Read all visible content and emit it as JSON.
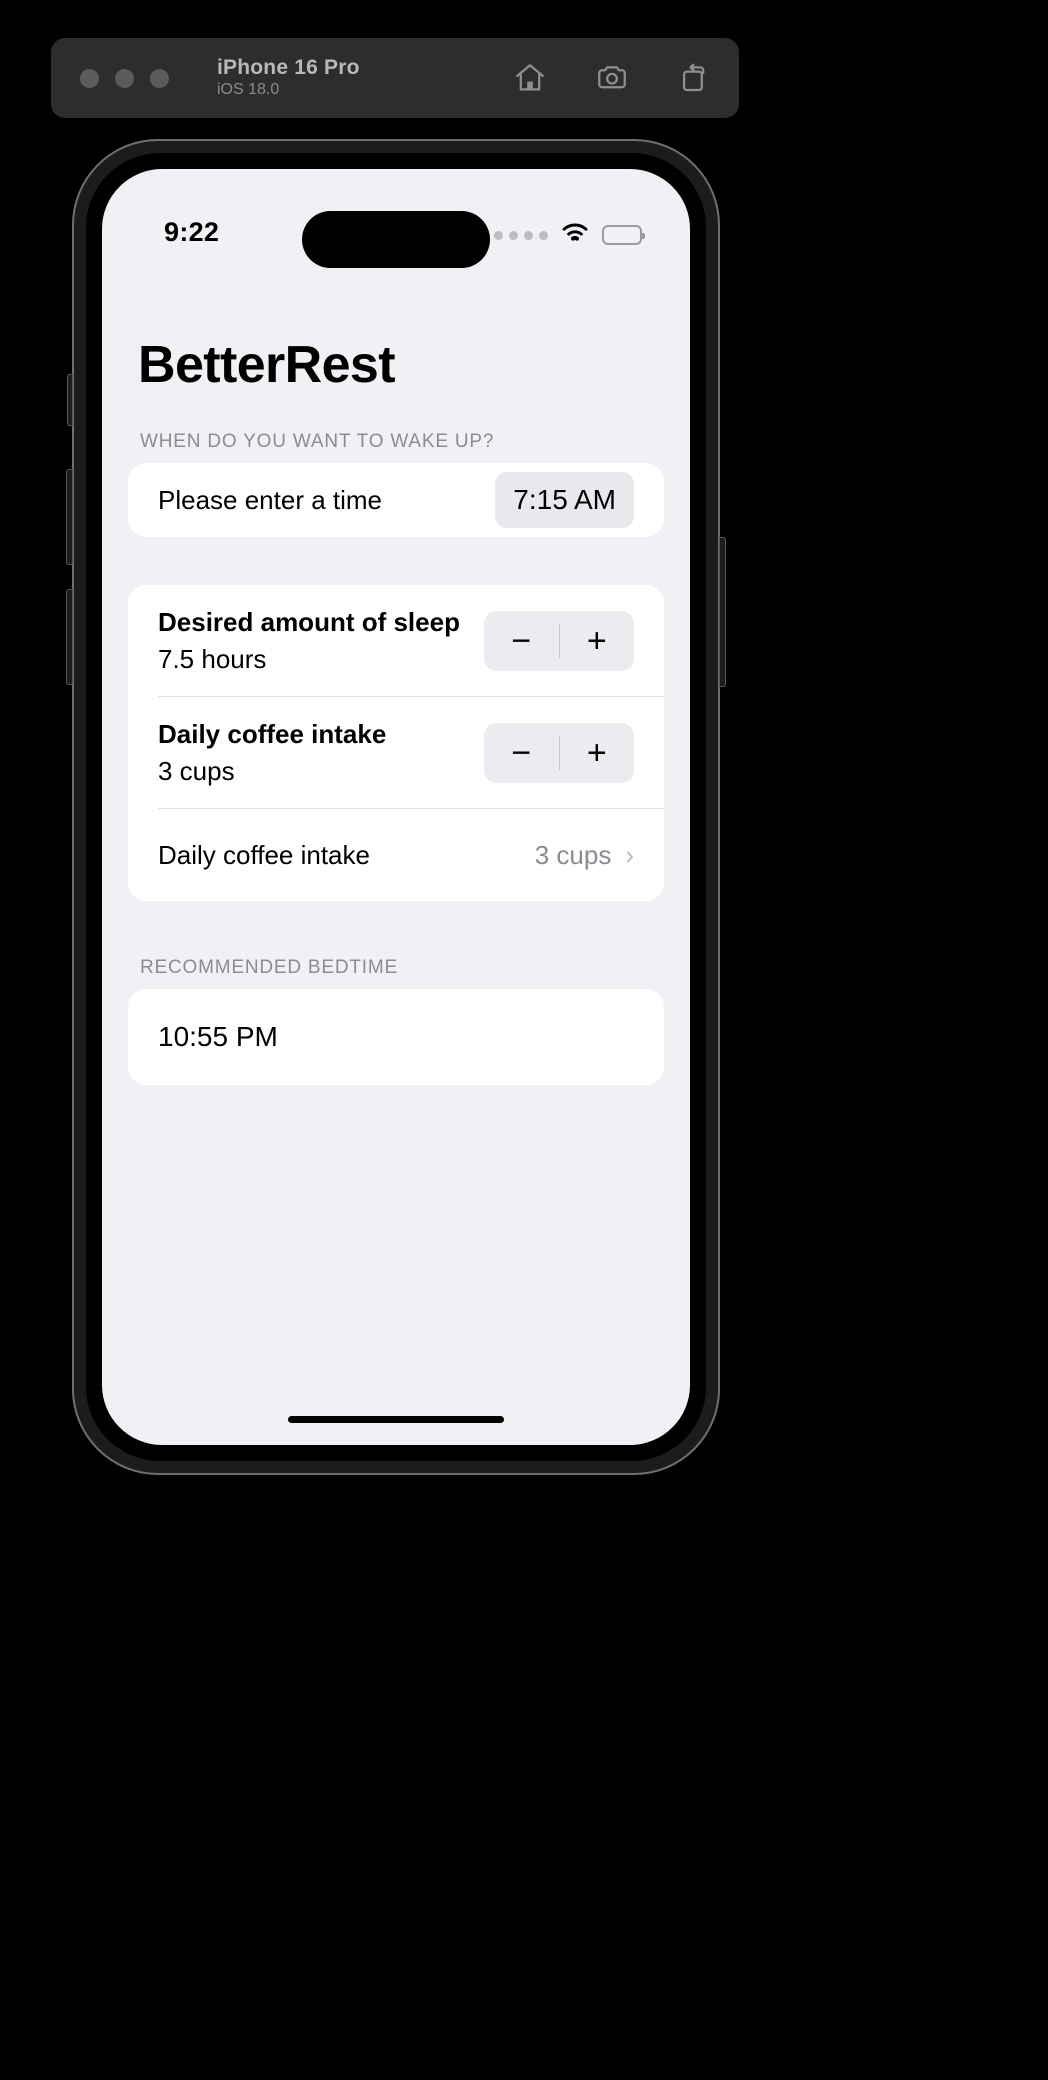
{
  "simulator": {
    "device_name": "iPhone 16 Pro",
    "os_version": "iOS 18.0",
    "icons": [
      "home-icon",
      "screenshot-camera-icon",
      "rotate-icon"
    ]
  },
  "status_bar": {
    "time": "9:22",
    "cellular": "cellular-signal-icon",
    "wifi": "wifi-icon",
    "battery": "battery-full-icon"
  },
  "app": {
    "title": "BetterRest",
    "sections": {
      "wake_up": {
        "header": "WHEN DO YOU WANT TO WAKE UP?",
        "label": "Please enter a time",
        "time_value": "7:15 AM"
      },
      "sleep": {
        "rows": [
          {
            "title": "Desired amount of sleep",
            "subtitle": "7.5 hours",
            "control": "stepper",
            "minus": "−",
            "plus": "+"
          },
          {
            "title": "Daily coffee intake",
            "subtitle": "3 cups",
            "control": "stepper",
            "minus": "−",
            "plus": "+"
          },
          {
            "title": "Daily coffee intake",
            "value": "3 cups",
            "control": "disclosure",
            "chevron": "›"
          }
        ]
      },
      "bedtime": {
        "header": "RECOMMENDED BEDTIME",
        "value": "10:55 PM"
      }
    }
  },
  "colors": {
    "page_background": "#000000",
    "toolbar_background": "#2d2d2d",
    "screen_background": "#f1f0f5",
    "card_background": "#ffffff",
    "section_header_text": "#8b8b93",
    "control_background": "#ececf0"
  }
}
